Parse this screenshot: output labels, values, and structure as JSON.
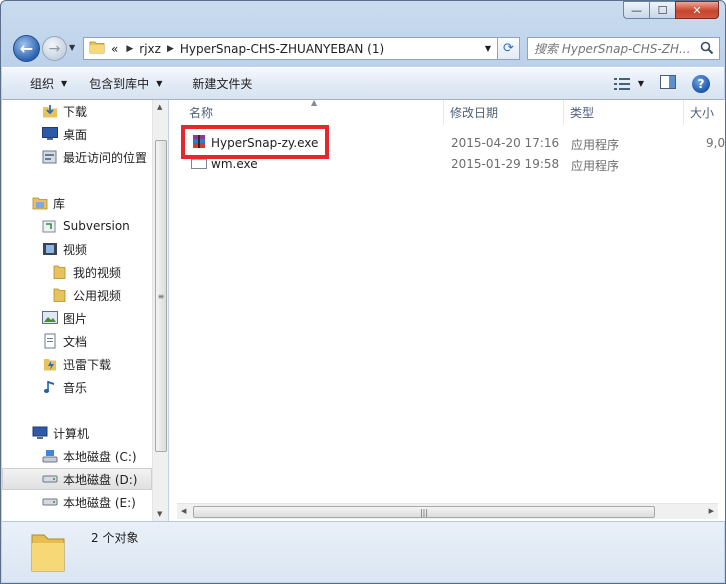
{
  "window": {
    "caption": {
      "minimize": "—",
      "maximize": "☐",
      "close": "✕"
    }
  },
  "navigation": {
    "breadcrumb_lead": "«",
    "breadcrumbs": [
      "rjxz",
      "HyperSnap-CHS-ZHUANYEBAN (1)"
    ],
    "search_placeholder": "搜索 HyperSnap-CHS-ZH..."
  },
  "toolbar": {
    "organize": "组织",
    "include_in_library": "包含到库中",
    "new_folder": "新建文件夹"
  },
  "sidebar": {
    "favorites": [
      {
        "label": "下载",
        "icon": "download-folder-icon"
      },
      {
        "label": "桌面",
        "icon": "desktop-icon"
      },
      {
        "label": "最近访问的位置",
        "icon": "recent-places-icon"
      }
    ],
    "libraries_label": "库",
    "libraries": [
      {
        "label": "Subversion",
        "icon": "subversion-icon"
      },
      {
        "label": "视频",
        "icon": "video-icon"
      },
      {
        "label": "我的视频",
        "icon": "folder-icon"
      },
      {
        "label": "公用视频",
        "icon": "folder-icon"
      },
      {
        "label": "图片",
        "icon": "pictures-icon"
      },
      {
        "label": "文档",
        "icon": "documents-icon"
      },
      {
        "label": "迅雷下载",
        "icon": "thunder-download-icon"
      },
      {
        "label": "音乐",
        "icon": "music-icon"
      }
    ],
    "computer_label": "计算机",
    "drives": [
      {
        "label": "本地磁盘 (C:)",
        "icon": "system-drive-icon"
      },
      {
        "label": "本地磁盘 (D:)",
        "icon": "drive-icon",
        "selected": true
      },
      {
        "label": "本地磁盘 (E:)",
        "icon": "drive-icon"
      }
    ]
  },
  "file_list": {
    "columns": [
      "名称",
      "修改日期",
      "类型",
      "大小"
    ],
    "rows": [
      {
        "name": "HyperSnap-zy.exe",
        "date": "2015-04-20 17:16",
        "type": "应用程序",
        "size": "9,0",
        "icon": "winrar-sfx-icon"
      },
      {
        "name": "wm.exe",
        "date": "2015-01-29 19:58",
        "type": "应用程序",
        "size": "",
        "icon": "exe-app-icon"
      }
    ]
  },
  "details_pane": {
    "item_count": "2 个对象"
  },
  "colors": {
    "highlight_box": "#e8262c",
    "window_frame": "#bdd2ea",
    "selection": "#e0e0e0"
  }
}
